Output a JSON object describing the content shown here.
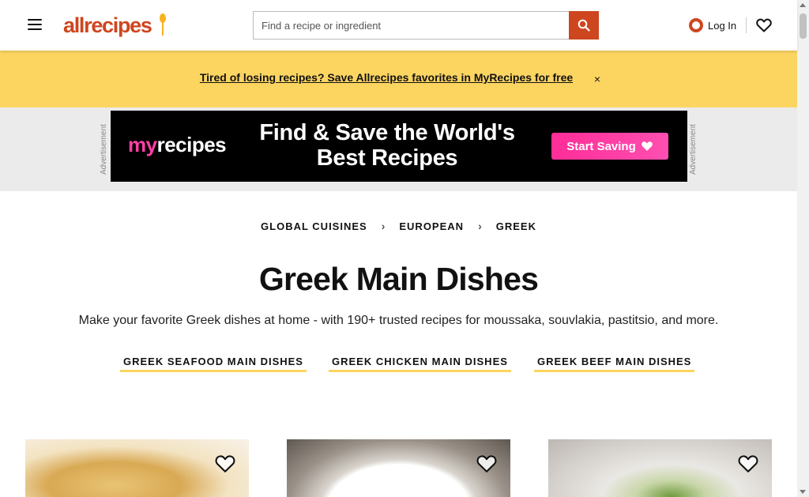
{
  "header": {
    "logo_text": "allrecipes",
    "search_placeholder": "Find a recipe or ingredient",
    "login_label": "Log In"
  },
  "promo": {
    "text": "Tired of losing recipes? Save Allrecipes favorites in MyRecipes for free",
    "close_label": "×"
  },
  "ad": {
    "label": "Advertisement",
    "brand_prefix": "my",
    "brand_suffix": "recipes",
    "headline": "Find & Save the World's Best Recipes",
    "cta_label": "Start Saving"
  },
  "breadcrumb": {
    "items": [
      {
        "label": "Global Cuisines"
      },
      {
        "label": "European"
      },
      {
        "label": "Greek"
      }
    ]
  },
  "page": {
    "title": "Greek Main Dishes",
    "intro": "Make your favorite Greek dishes at home - with 190+ trusted recipes for moussaka, souvlakia, pastitsio, and more."
  },
  "subcategories": [
    {
      "label": "Greek Seafood Main Dishes"
    },
    {
      "label": "Greek Chicken Main Dishes"
    },
    {
      "label": "Greek Beef Main Dishes"
    }
  ],
  "colors": {
    "brand": "#ce4620",
    "promo_bg": "#fcd561",
    "ad_accent": "#ff2d97"
  },
  "icons": [
    "menu-icon",
    "search-icon",
    "user-icon",
    "heart-icon",
    "chevron-right-icon"
  ]
}
